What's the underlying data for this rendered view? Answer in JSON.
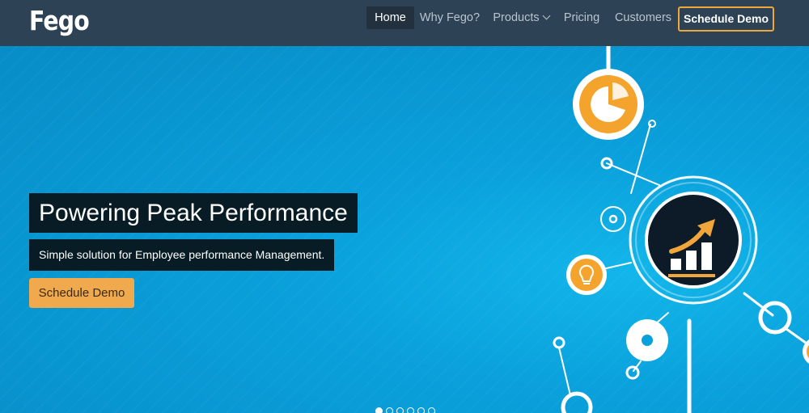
{
  "brand": {
    "logo": "Fego"
  },
  "nav": {
    "items": [
      {
        "label": "Home",
        "active": true
      },
      {
        "label": "Why Fego?"
      },
      {
        "label": "Products",
        "has_dropdown": true
      },
      {
        "label": "Pricing"
      },
      {
        "label": "Customers"
      }
    ],
    "cta_label": "Schedule Demo"
  },
  "hero": {
    "title": "Powering Peak Performance",
    "subtitle": "Simple solution for Employee performance Management.",
    "cta_label": "Schedule Demo"
  },
  "carousel": {
    "slide_count": 6,
    "active_index": 0
  },
  "colors": {
    "navbar": "#2d4255",
    "hero_bg": "#0a9ad3",
    "accent": "#f0a63a",
    "caption_bg": "#071c24"
  },
  "graphic_icons": [
    "pie-chart-icon",
    "growth-chart-icon",
    "lightbulb-icon"
  ]
}
